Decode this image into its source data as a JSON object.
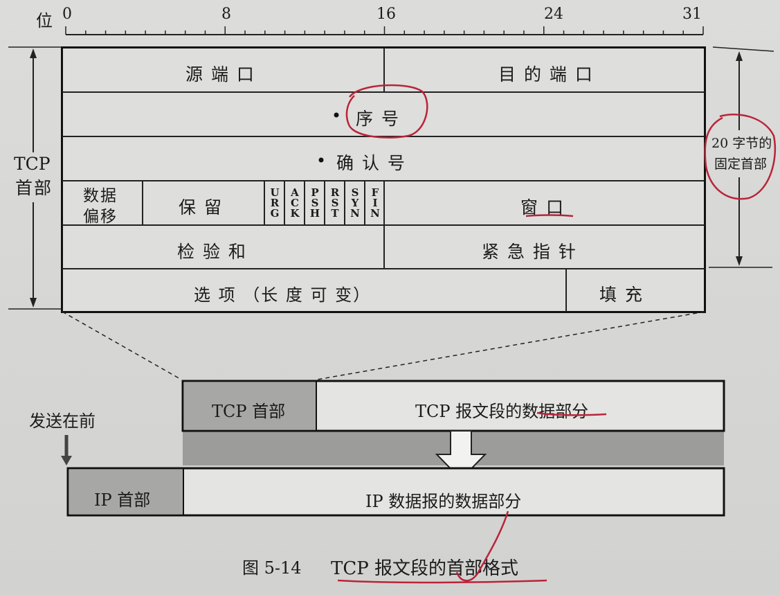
{
  "ruler": {
    "unit_label": "位",
    "marks": [
      "0",
      "8",
      "16",
      "24",
      "31"
    ]
  },
  "header_side_label": {
    "line1": "TCP",
    "line2": "首部"
  },
  "fixed_header_note": {
    "line1": "20 字节的",
    "line2": "固定首部"
  },
  "fields": {
    "src_port": "源 端 口",
    "dst_port": "目 的 端 口",
    "seq": "序 号",
    "ack": "确 认 号",
    "offset_line1": "数据",
    "offset_line2": "偏移",
    "reserved": "保 留",
    "flags": [
      "URG",
      "ACK",
      "PSH",
      "RST",
      "SYN",
      "FIN"
    ],
    "window": "窗 口",
    "checksum": "检 验 和",
    "urgent": "紧 急 指 针",
    "options": "选 项 （长 度 可 变）",
    "padding": "填 充"
  },
  "segment": {
    "header": "TCP 首部",
    "data": "TCP 报文段的数据部分"
  },
  "send_first": "发送在前",
  "ip": {
    "header": "IP 首部",
    "data": "IP 数据报的数据部分"
  },
  "caption": {
    "number": "图 5-14",
    "title": "TCP 报文段的首部格式"
  },
  "colors": {
    "ink": "#111111",
    "annotation": "#b8243a",
    "paper": "#d9d9d7",
    "shade": "#9a9a98"
  }
}
